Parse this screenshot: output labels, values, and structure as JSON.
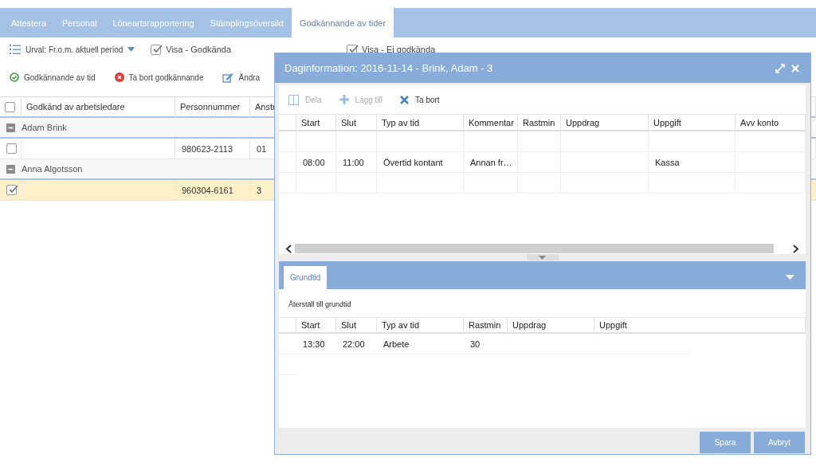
{
  "tabs": [
    {
      "label": "Attestera",
      "selected": false
    },
    {
      "label": "Personal",
      "selected": false
    },
    {
      "label": "Löneartsrapportering",
      "selected": false
    },
    {
      "label": "Stämplingsöversikt",
      "selected": false
    },
    {
      "label": "Godkännande av tider",
      "selected": true
    }
  ],
  "filter": {
    "label": "Urval: Fr.o.m. aktuell period"
  },
  "show_checks": [
    {
      "label": "Visa - Godkända",
      "checked": true
    },
    {
      "label": "Visa - Ej godkända",
      "checked": true
    }
  ],
  "actions": [
    {
      "label": "Godkännande av tid",
      "kind": "approve"
    },
    {
      "label": "Ta bort godkännande",
      "kind": "remove"
    },
    {
      "label": "Ändra",
      "kind": "edit"
    }
  ],
  "table": {
    "all_checked": false,
    "columns": [
      "Godkänd av arbetsledare",
      "Personnummer",
      "Anstr"
    ],
    "groups": [
      {
        "name": "Adam Brink",
        "expanded": true,
        "rows": [
          {
            "checked": false,
            "selected": false,
            "cells": [
              null,
              "980623-2113",
              "01"
            ]
          }
        ]
      },
      {
        "name": "Anna Algotsson",
        "expanded": true,
        "rows": [
          {
            "checked": true,
            "selected": true,
            "cells": [
              null,
              "960304-6161",
              "3"
            ]
          }
        ]
      }
    ]
  },
  "dialog": {
    "title": "Daginformation: 2016-11-14 - Brink, Adam - 3",
    "toolbar": [
      {
        "label": "Dela",
        "kind": "split",
        "disabled": true
      },
      {
        "label": "Lägg till",
        "kind": "add",
        "disabled": true
      },
      {
        "label": "Ta bort",
        "kind": "delete",
        "disabled": false
      }
    ],
    "grid": {
      "columns": [
        "Start",
        "Slut",
        "Typ av tid",
        "Kommentar",
        "Rastmin",
        "Uppdrag",
        "Uppgift",
        "Avv konto"
      ],
      "rows": [
        {
          "kind": "empty"
        },
        {
          "kind": "data",
          "cells": [
            "08:00",
            "11:00",
            "Övertid kontant",
            "Annan fr…",
            null,
            null,
            "Kassa",
            null
          ]
        },
        {
          "kind": "empty"
        }
      ]
    },
    "lower": {
      "tabs": [
        {
          "label": "Grundtid",
          "selected": true
        }
      ],
      "reset_link": "Återställ till grundtid",
      "grid": {
        "columns": [
          "Start",
          "Slut",
          "Typ av tid",
          "Rastmin",
          "Uppdrag",
          "Uppgift"
        ],
        "rows": [
          {
            "kind": "data",
            "cells": [
              "13:30",
              "22:00",
              "Arbete",
              "30",
              null,
              null
            ]
          }
        ]
      }
    },
    "buttons": [
      {
        "label": "Spara"
      },
      {
        "label": "Avbryt"
      }
    ]
  }
}
